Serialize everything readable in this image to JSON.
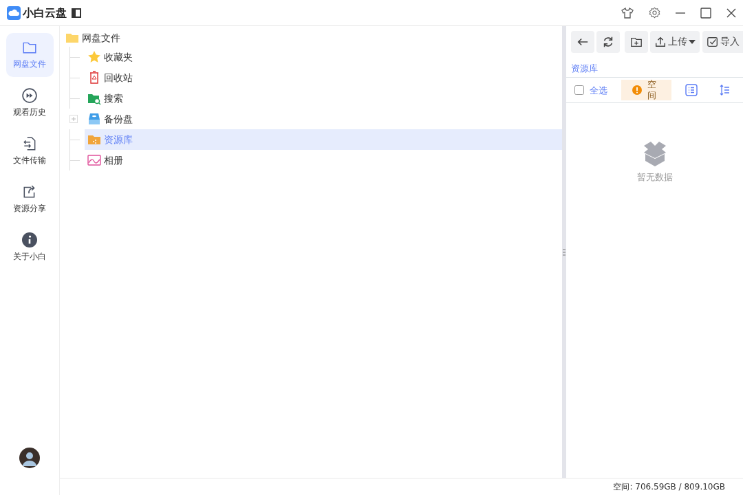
{
  "window": {
    "title": "小白云盘"
  },
  "nav": [
    {
      "label": "网盘文件",
      "kind": "folder",
      "selected": true
    },
    {
      "label": "观看历史",
      "kind": "play",
      "selected": false
    },
    {
      "label": "文件传输",
      "kind": "transfer",
      "selected": false
    },
    {
      "label": "资源分享",
      "kind": "share",
      "selected": false
    },
    {
      "label": "关于小白",
      "kind": "info",
      "selected": false
    }
  ],
  "tree": {
    "label": "网盘文件",
    "kind": "folder",
    "selected": false,
    "children": [
      {
        "label": "收藏夹",
        "kind": "star",
        "selected": false
      },
      {
        "label": "回收站",
        "kind": "trash",
        "selected": false
      },
      {
        "label": "搜索",
        "kind": "search",
        "selected": false
      },
      {
        "label": "备份盘",
        "kind": "drive",
        "selected": false,
        "expanded": false
      },
      {
        "label": "资源库",
        "kind": "library",
        "selected": true
      },
      {
        "label": "相册",
        "kind": "photo",
        "selected": false
      }
    ]
  },
  "toolbar": [
    {
      "kind": "back"
    },
    {
      "kind": "refresh"
    },
    {
      "kind": "new-folder"
    },
    {
      "kind": "upload",
      "label": "上传"
    },
    {
      "kind": "import",
      "label": "导入"
    }
  ],
  "breadcrumb": "资源库",
  "select_all": {
    "label": "全选",
    "checked": false
  },
  "warning": "空间",
  "empty": "暂无数据",
  "status_bar": "空间: 706.59GB / 809.10GB"
}
